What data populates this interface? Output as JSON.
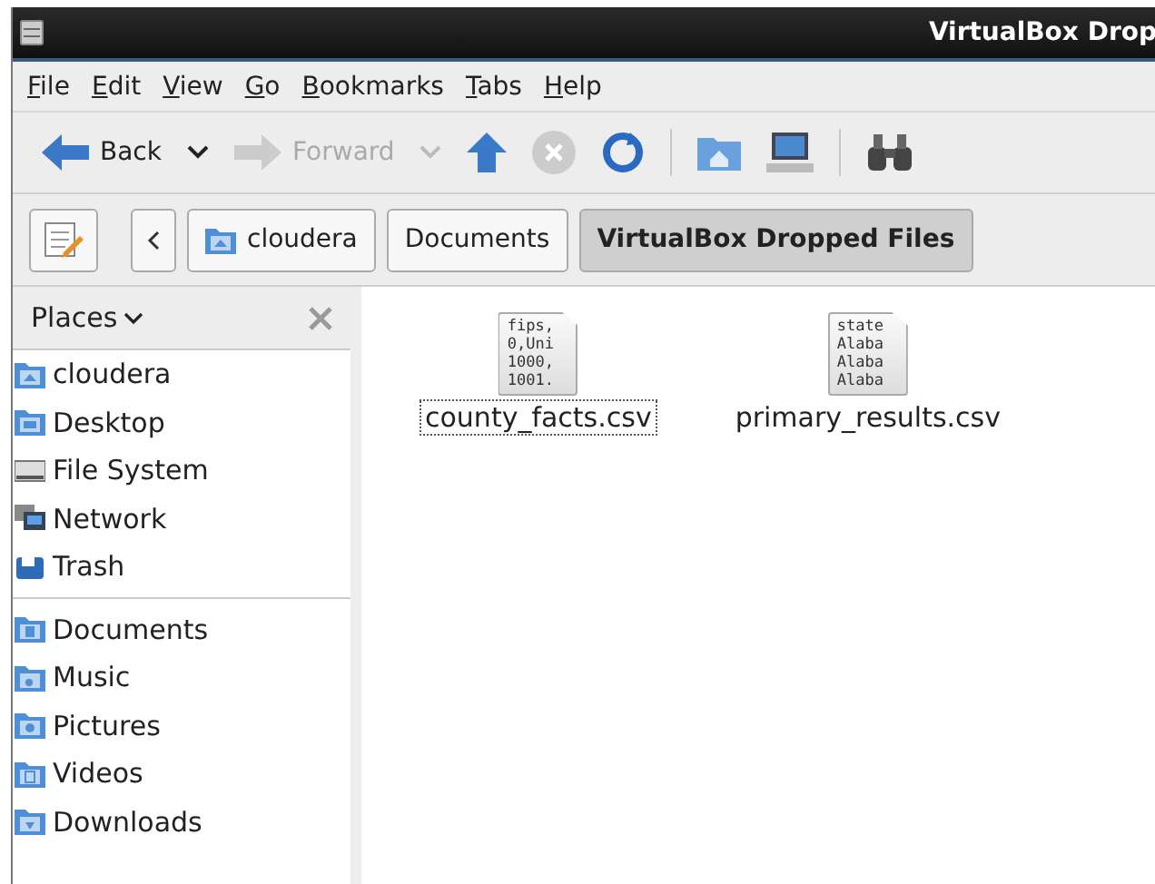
{
  "window": {
    "title": "VirtualBox Drop"
  },
  "menu": [
    "File",
    "Edit",
    "View",
    "Go",
    "Bookmarks",
    "Tabs",
    "Help"
  ],
  "toolbar": [
    {
      "kind": "back",
      "label": "Back",
      "disabled": false,
      "dropdown": true
    },
    {
      "kind": "forward",
      "label": "Forward",
      "disabled": true,
      "dropdown": true
    },
    {
      "kind": "up",
      "disabled": false
    },
    {
      "kind": "stop",
      "disabled": true
    },
    {
      "kind": "reload",
      "disabled": false
    },
    {
      "kind": "separator"
    },
    {
      "kind": "home"
    },
    {
      "kind": "computer"
    },
    {
      "kind": "separator"
    },
    {
      "kind": "search"
    }
  ],
  "path_bar": [
    {
      "label": "cloudera",
      "kind": "home",
      "selected": false
    },
    {
      "label": "Documents",
      "selected": false
    },
    {
      "label": "VirtualBox Dropped Files",
      "selected": true
    }
  ],
  "sidebar": {
    "title": "Places",
    "groups": [
      [
        {
          "label": "cloudera",
          "kind": "home"
        },
        {
          "label": "Desktop",
          "kind": "desktop"
        },
        {
          "label": "File System",
          "kind": "drive"
        },
        {
          "label": "Network",
          "kind": "network"
        },
        {
          "label": "Trash",
          "kind": "trash"
        }
      ],
      [
        {
          "label": "Documents",
          "kind": "documents"
        },
        {
          "label": "Music",
          "kind": "music"
        },
        {
          "label": "Pictures",
          "kind": "pictures"
        },
        {
          "label": "Videos",
          "kind": "videos"
        },
        {
          "label": "Downloads",
          "kind": "downloads"
        }
      ]
    ]
  },
  "files": [
    {
      "name": "county_facts.csv",
      "focused": true,
      "preview": [
        "fips,",
        "0,Uni",
        "1000,",
        "1001."
      ]
    },
    {
      "name": "primary_results.csv",
      "focused": false,
      "preview": [
        "state",
        "Alaba",
        "Alaba",
        "Alaba"
      ]
    }
  ]
}
